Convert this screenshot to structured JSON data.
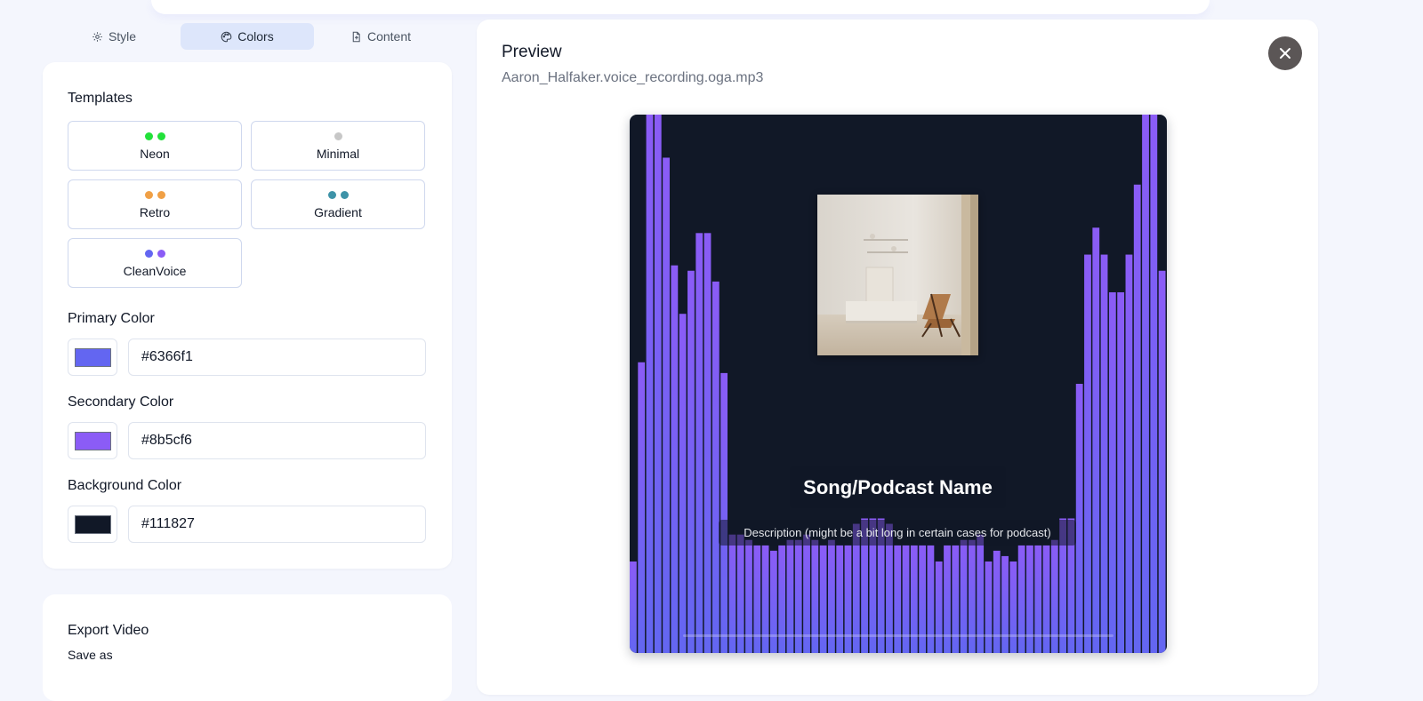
{
  "tabs": [
    {
      "label": "Style",
      "icon": "gear-icon"
    },
    {
      "label": "Colors",
      "icon": "palette-icon",
      "active": true
    },
    {
      "label": "Content",
      "icon": "file-icon"
    }
  ],
  "templates": {
    "title": "Templates",
    "items": [
      {
        "label": "Neon",
        "dots": [
          "#22e13a",
          "#22e13a"
        ]
      },
      {
        "label": "Minimal",
        "dots": [
          "#c7c7c7"
        ]
      },
      {
        "label": "Retro",
        "dots": [
          "#f0a046",
          "#f0a046"
        ]
      },
      {
        "label": "Gradient",
        "dots": [
          "#3e93a8",
          "#3e93a8"
        ]
      },
      {
        "label": "CleanVoice",
        "dots": [
          "#6366f1",
          "#8b5cf6"
        ]
      }
    ]
  },
  "colors": {
    "primary": {
      "label": "Primary Color",
      "value": "#6366f1"
    },
    "secondary": {
      "label": "Secondary Color",
      "value": "#8b5cf6"
    },
    "background": {
      "label": "Background Color",
      "value": "#111827"
    }
  },
  "export": {
    "title": "Export Video",
    "save_as": "Save as"
  },
  "preview": {
    "title": "Preview",
    "filename": "Aaron_Halfaker.voice_recording.oga.mp3",
    "song_title": "Song/Podcast Name",
    "description": "Description (might be a bit long in certain cases for podcast)"
  },
  "visualizer": {
    "bars": [
      0.17,
      0.54,
      1.0,
      1.0,
      0.92,
      0.72,
      0.63,
      0.71,
      0.78,
      0.78,
      0.69,
      0.52,
      0.22,
      0.22,
      0.21,
      0.2,
      0.2,
      0.19,
      0.2,
      0.21,
      0.21,
      0.22,
      0.21,
      0.2,
      0.21,
      0.2,
      0.2,
      0.24,
      0.25,
      0.25,
      0.25,
      0.24,
      0.2,
      0.2,
      0.2,
      0.2,
      0.2,
      0.17,
      0.2,
      0.2,
      0.21,
      0.21,
      0.22,
      0.17,
      0.19,
      0.18,
      0.17,
      0.2,
      0.2,
      0.2,
      0.2,
      0.21,
      0.25,
      0.25,
      0.5,
      0.74,
      0.79,
      0.74,
      0.67,
      0.67,
      0.74,
      0.87,
      1.0,
      1.0,
      0.71
    ],
    "primary_color": "#6366f1",
    "secondary_color": "#8b5cf6",
    "background_color": "#111827"
  }
}
